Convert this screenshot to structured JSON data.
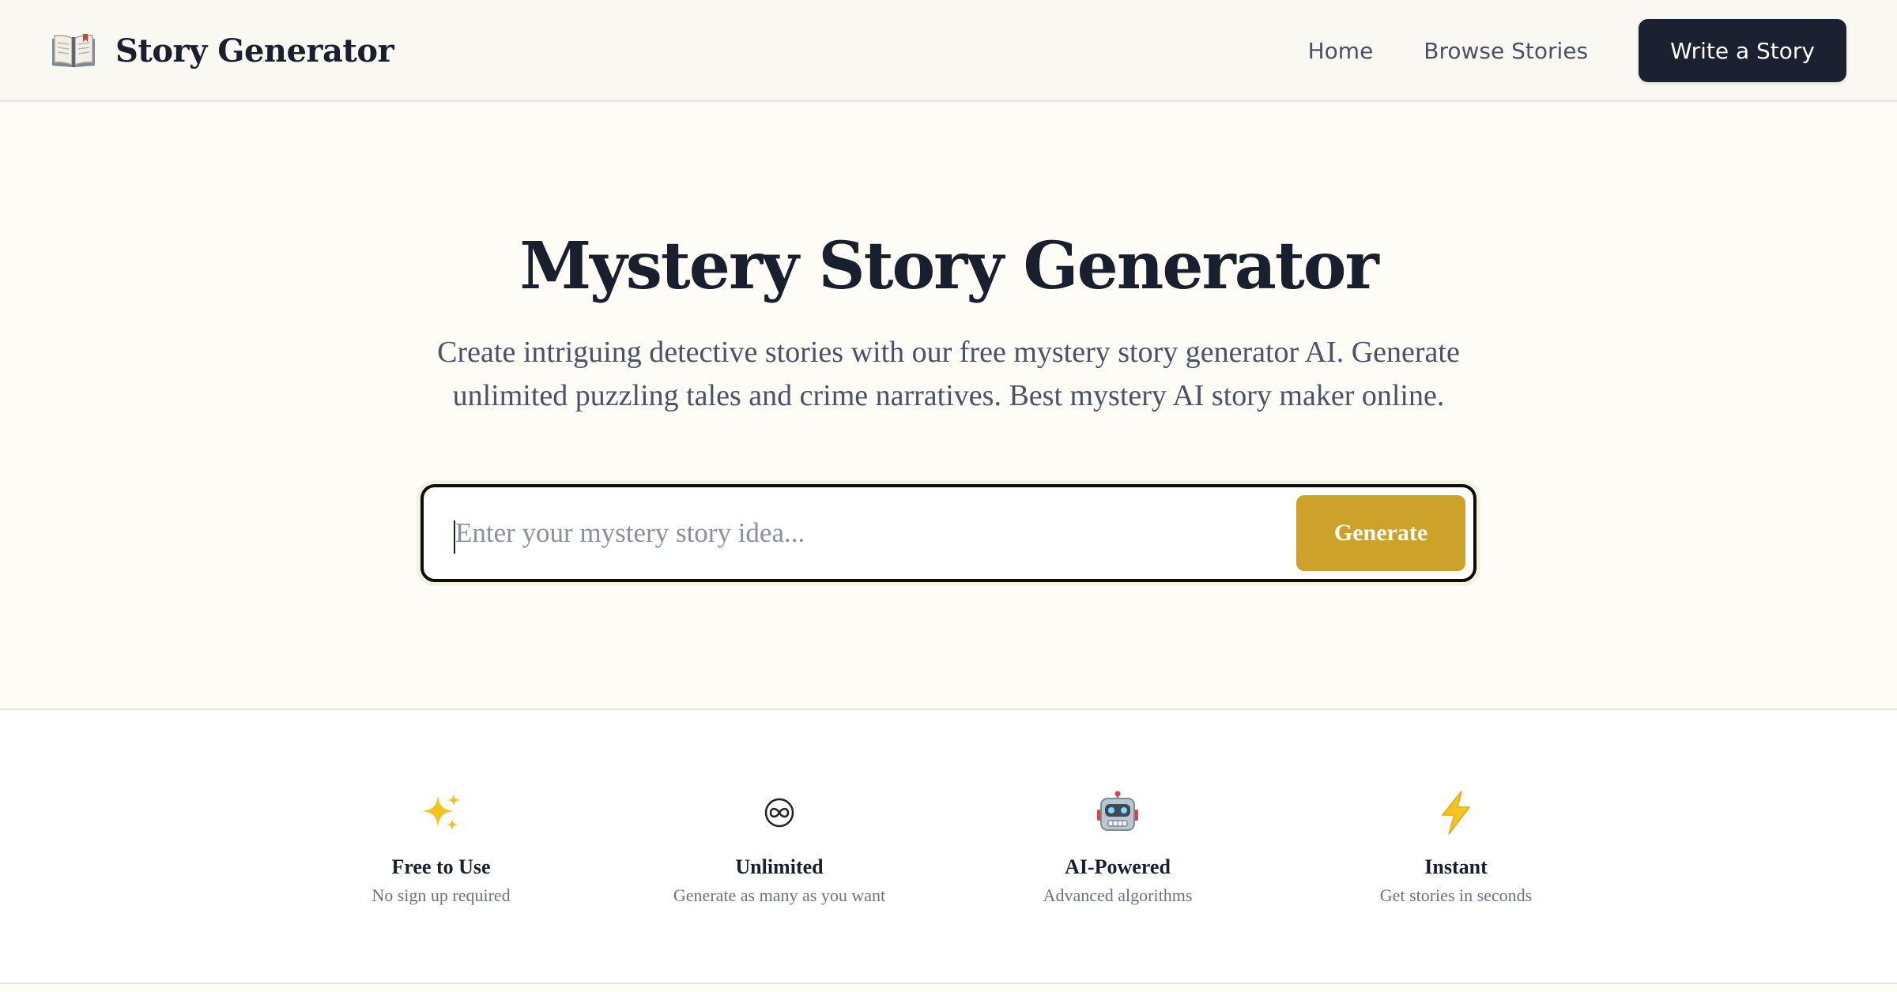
{
  "header": {
    "brand_name": "Story Generator",
    "brand_icon": "open-book-icon",
    "nav": {
      "home": "Home",
      "browse": "Browse Stories",
      "write": "Write a Story"
    }
  },
  "hero": {
    "title": "Mystery Story Generator",
    "subtitle": "Create intriguing detective stories with our free mystery story generator AI. Generate unlimited puzzling tales and crime narratives. Best mystery AI story maker online.",
    "search": {
      "placeholder": "Enter your mystery story idea...",
      "value": ""
    },
    "generate_label": "Generate"
  },
  "features": [
    {
      "icon": "sparkles-icon",
      "title": "Free to Use",
      "desc": "No sign up required"
    },
    {
      "icon": "infinity-icon",
      "title": "Unlimited",
      "desc": "Generate as many as you want"
    },
    {
      "icon": "robot-icon",
      "title": "AI-Powered",
      "desc": "Advanced algorithms"
    },
    {
      "icon": "lightning-icon",
      "title": "Instant",
      "desc": "Get stories in seconds"
    }
  ],
  "colors": {
    "accent": "#cda22a",
    "dark_button": "#1b2130",
    "background": "#fdfcf7"
  }
}
